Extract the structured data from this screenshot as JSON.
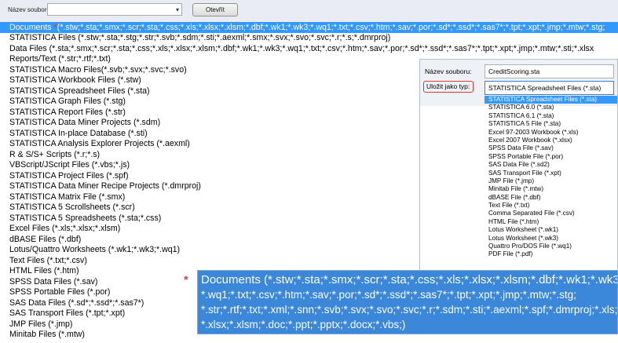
{
  "toolbar": {
    "filename_label": "Název souboru:",
    "filename_value": "",
    "open_label": "Otevřít"
  },
  "file_types": [
    {
      "label": "Documents (*.stw;*.sta;*.smx;*.scr;*.sta;*.css;*.xls;*.xlsx;*.xlsm;*.dbf;*.wk1;*.wk3;*.wq1;*.txt;*.csv;*.htm;*.sav;*.por;*.sd*;*.ssd*;*.sas7*;*.tpt;*.xpt;*.jmp;*.mtw;*.stg;",
      "selected": true
    },
    {
      "label": "STATISTICA Files (*.stw;*.sta;*.stg;*.str;*.svb;*.sdm;*.sti;*.aexml;*.smx;*.svx;*.svo;*.svc;*.r;*.s;*.dmrproj)"
    },
    {
      "label": "Data Files (*.sta;*.smx;*.scr;*.sta;*.css;*.xls;*.xlsx;*.xlsm;*.dbf;*.wk1;*.wk3;*.wq1;*.txt;*.csv;*.htm;*.sav;*.por;*.sd*;*.ssd*;*.sas7*;*.tpt;*.xpt;*.jmp;*.mtw;*.sti;*.xlsx"
    },
    {
      "label": "Reports/Text (*.str;*.rtf;*.txt)"
    },
    {
      "label": "STATISTICA Macro Files(*.svb;*.svx;*.svc;*.svo)"
    },
    {
      "label": "STATISTICA Workbook Files (*.stw)"
    },
    {
      "label": "STATISTICA Spreadsheet Files (*.sta)"
    },
    {
      "label": "STATISTICA Graph Files (*.stg)"
    },
    {
      "label": "STATISTICA Report Files (*.str)"
    },
    {
      "label": "STATISTICA Data Miner Projects (*.sdm)"
    },
    {
      "label": "STATISTICA In-place Database (*.sti)"
    },
    {
      "label": "STATISTICA Analysis Explorer Projects (*.aexml)"
    },
    {
      "label": "R & S/S+ Scripts (*.r;*.s)"
    },
    {
      "label": "VBScript/JScript Files (*.vbs;*.js)"
    },
    {
      "label": "STATISTICA Project Files (*.spf)"
    },
    {
      "label": "STATISTICA Data Miner Recipe Projects (*.dmrproj)"
    },
    {
      "label": "STATISTICA Matrix File (*.smx)"
    },
    {
      "label": "STATISTICA 5 Scrollsheets (*.scr)"
    },
    {
      "label": "STATISTICA 5 Spreadsheets (*.sta;*.css)"
    },
    {
      "label": "Excel Files (*.xls;*.xlsx;*.xlsm)"
    },
    {
      "label": "dBASE Files (*.dbf)"
    },
    {
      "label": "Lotus/Quattro Worksheets (*.wk1;*.wk3;*.wq1)"
    },
    {
      "label": "Text Files (*.txt;*.csv)"
    },
    {
      "label": "HTML Files (*.htm)"
    },
    {
      "label": "SPSS Data Files (*.sav)"
    },
    {
      "label": "SPSS Portable Files (*.por)"
    },
    {
      "label": "SAS Data Files (*.sd*;*.ssd*;*.sas7*)"
    },
    {
      "label": "SAS Transport Files (*.tpt;*.xpt)"
    },
    {
      "label": "JMP Files (*.jmp)"
    },
    {
      "label": "Minitab Files (*.mtw)"
    }
  ],
  "save_dialog": {
    "filename_label": "Název souboru:",
    "filename_value": "CreditScoring.sta",
    "type_label": "Uložit jako typ:",
    "type_value": "STATISTICA Spreadsheet Files (*.sta)",
    "type_options": [
      {
        "label": "STATISTICA Spreadsheet Files (*.sta)",
        "selected": true
      },
      {
        "label": "STATISTICA 6.0 (*.sta)"
      },
      {
        "label": "STATISTICA 6.1 (*.sta)"
      },
      {
        "label": "STATISTICA 5 File (*.sta)"
      },
      {
        "label": "Excel 97-2003 Workbook (*.xls)"
      },
      {
        "label": "Excel 2007 Workbook (*.xlsx)"
      },
      {
        "label": "SPSS Data File (*.sav)"
      },
      {
        "label": "SPSS Portable File (*.por)"
      },
      {
        "label": "SAS Data File (*.sd2)"
      },
      {
        "label": "SAS Transport File (*.xpt)"
      },
      {
        "label": "JMP File (*.jmp)"
      },
      {
        "label": "Minitab File (*.mtw)"
      },
      {
        "label": "dBASE File (*.dbf)"
      },
      {
        "label": "Text File (*.txt)"
      },
      {
        "label": "Comma Separated File (*.csv)"
      },
      {
        "label": "HTML File (*.htm)"
      },
      {
        "label": "Lotus Worksheet (*.wk1)"
      },
      {
        "label": "Lotus Worksheet (*.wk3)"
      },
      {
        "label": "Quattro Pro/DOS File (*.wq1)"
      },
      {
        "label": "PDF File (*.pdf)"
      }
    ]
  },
  "zoom_callout": {
    "lines": [
      "Documents (*.stw;*.sta;*.smx;*.scr;*.sta;*.css;*.xls;*.xlsx;*.xlsm;*.dbf;*.wk1;*.wk3;",
      "*.wq1;*.txt;*.csv;*.htm;*.sav;*.por;*.sd*;*.ssd*;*.sas7*;*.tpt;*.xpt;*.jmp;*.mtw;*.stg;",
      "*.str;*.rtf;*.txt;*.xml;*.snn;*.svb;*.svx;*.svo;*.svc;*.r;*.sdm;*.sti;*.aexml;*.spf;*.dmrproj;*.xls;",
      "*.xlsx;*.xlsm;*.doc;*.ppt;*.pptx;*.docx;*.vbs;)"
    ]
  },
  "colors": {
    "selection": "#3399ff",
    "callout_border": "#d63b3b",
    "zoom_bg": "#3b87d9"
  },
  "icons": {
    "star": "red-asterisk-icon",
    "dropdown": "chevron-down-icon"
  }
}
